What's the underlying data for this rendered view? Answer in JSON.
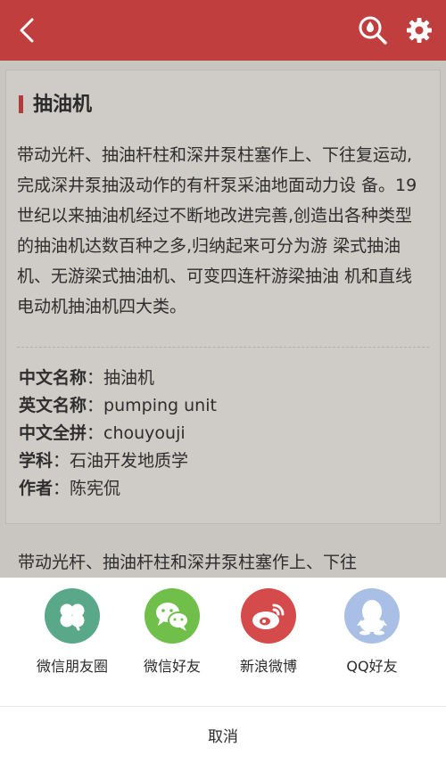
{
  "header": {
    "back_icon": "chevron-left-icon",
    "search_icon": "drop-search-icon",
    "settings_icon": "gear-icon",
    "accent": "#c13e3e"
  },
  "entry": {
    "title": "抽油机",
    "description": "带动光杆、抽油杆柱和深井泵柱塞作上、下往复运动,完成深井泵抽汲动作的有杆泵采油地面动力设 备。19 世纪以来抽油机经过不断地改进完善,创造出各种类型的抽油机达数百种之多,归纳起来可分为游 梁式抽油机、无游梁式抽油机、可变四连杆游梁抽油 机和直线电动机抽油机四大类。",
    "props": [
      {
        "key": "中文名称",
        "sep": "：",
        "value": "抽油机"
      },
      {
        "key": "英文名称",
        "sep": "：",
        "value": "pumping unit"
      },
      {
        "key": "中文全拼",
        "sep": "：",
        "value": "chouyouji"
      },
      {
        "key": "学科",
        "sep": "：",
        "value": "石油开发地质学"
      },
      {
        "key": "作者",
        "sep": "：",
        "value": "陈宪侃"
      }
    ],
    "more_text": "带动光杆、抽油杆柱和深井泵柱塞作上、下往"
  },
  "share": {
    "items": [
      {
        "label": "微信朋友圈",
        "icon": "clover-icon",
        "color": "#5aa88a"
      },
      {
        "label": "微信好友",
        "icon": "wechat-icon",
        "color": "#6fbf4a"
      },
      {
        "label": "新浪微博",
        "icon": "weibo-icon",
        "color": "#d54b4b"
      },
      {
        "label": "QQ好友",
        "icon": "qq-icon",
        "color": "#a9bfe6"
      }
    ],
    "cancel_label": "取消"
  }
}
